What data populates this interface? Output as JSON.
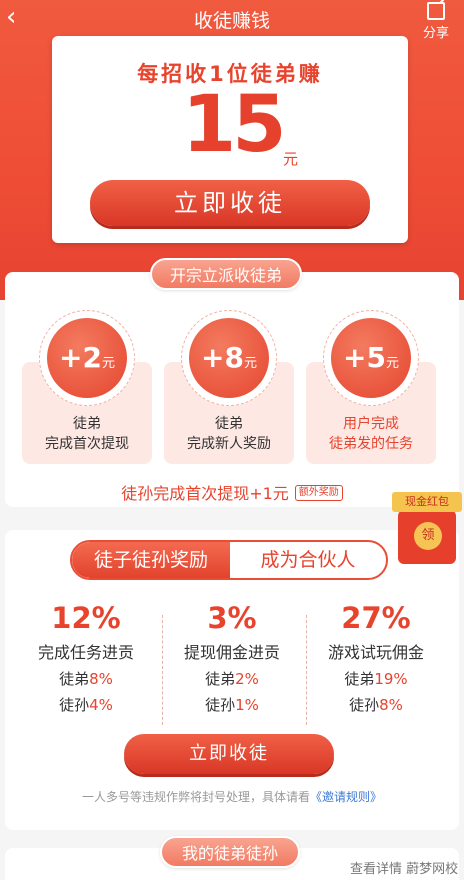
{
  "nav": {
    "back_glyph": "‹",
    "title": "收徒赚钱",
    "share_label": "分享",
    "share_icon": "share-icon"
  },
  "hero": {
    "headline": "每招收1位徒弟赚",
    "amount": "15",
    "unit": "元",
    "cta": "立即收徒"
  },
  "section1": {
    "pill": "开宗立派收徒弟",
    "features": [
      {
        "value": "+2",
        "unit": "元",
        "line1": "徒弟",
        "line2": "完成首次提现"
      },
      {
        "value": "+8",
        "unit": "元",
        "line1": "徒弟",
        "line2": "完成新人奖励"
      },
      {
        "value": "+5",
        "unit": "元",
        "line1": "用户完成",
        "line2": "徒弟发的任务"
      }
    ],
    "extra_text": "徒孙完成首次提现+1元",
    "extra_tag": "额外奖励"
  },
  "redpack": {
    "label": "现金红包",
    "coin": "领"
  },
  "section2": {
    "tabs": [
      "徒子徒孙奖励",
      "成为合伙人"
    ],
    "columns": [
      {
        "pct": "12%",
        "name": "完成任务进贡",
        "l1": "徒弟",
        "v1": "8%",
        "l2": "徒孙",
        "v2": "4%"
      },
      {
        "pct": "3%",
        "name": "提现佣金进贡",
        "l1": "徒弟",
        "v1": "2%",
        "l2": "徒孙",
        "v2": "1%"
      },
      {
        "pct": "27%",
        "name": "游戏试玩佣金",
        "l1": "徒弟",
        "v1": "19%",
        "l2": "徒孙",
        "v2": "8%"
      }
    ],
    "cta": "立即收徒",
    "rule_text": "一人多号等违规作弊将封号处理，具体请看",
    "rule_link": "《邀请规则》"
  },
  "section3": {
    "pill": "我的徒弟徒孙"
  },
  "watermark": "查看详情 蔚梦网校",
  "colors": {
    "primary": "#e8432d",
    "header": "#f05a3f",
    "link": "#3d7ad6"
  }
}
